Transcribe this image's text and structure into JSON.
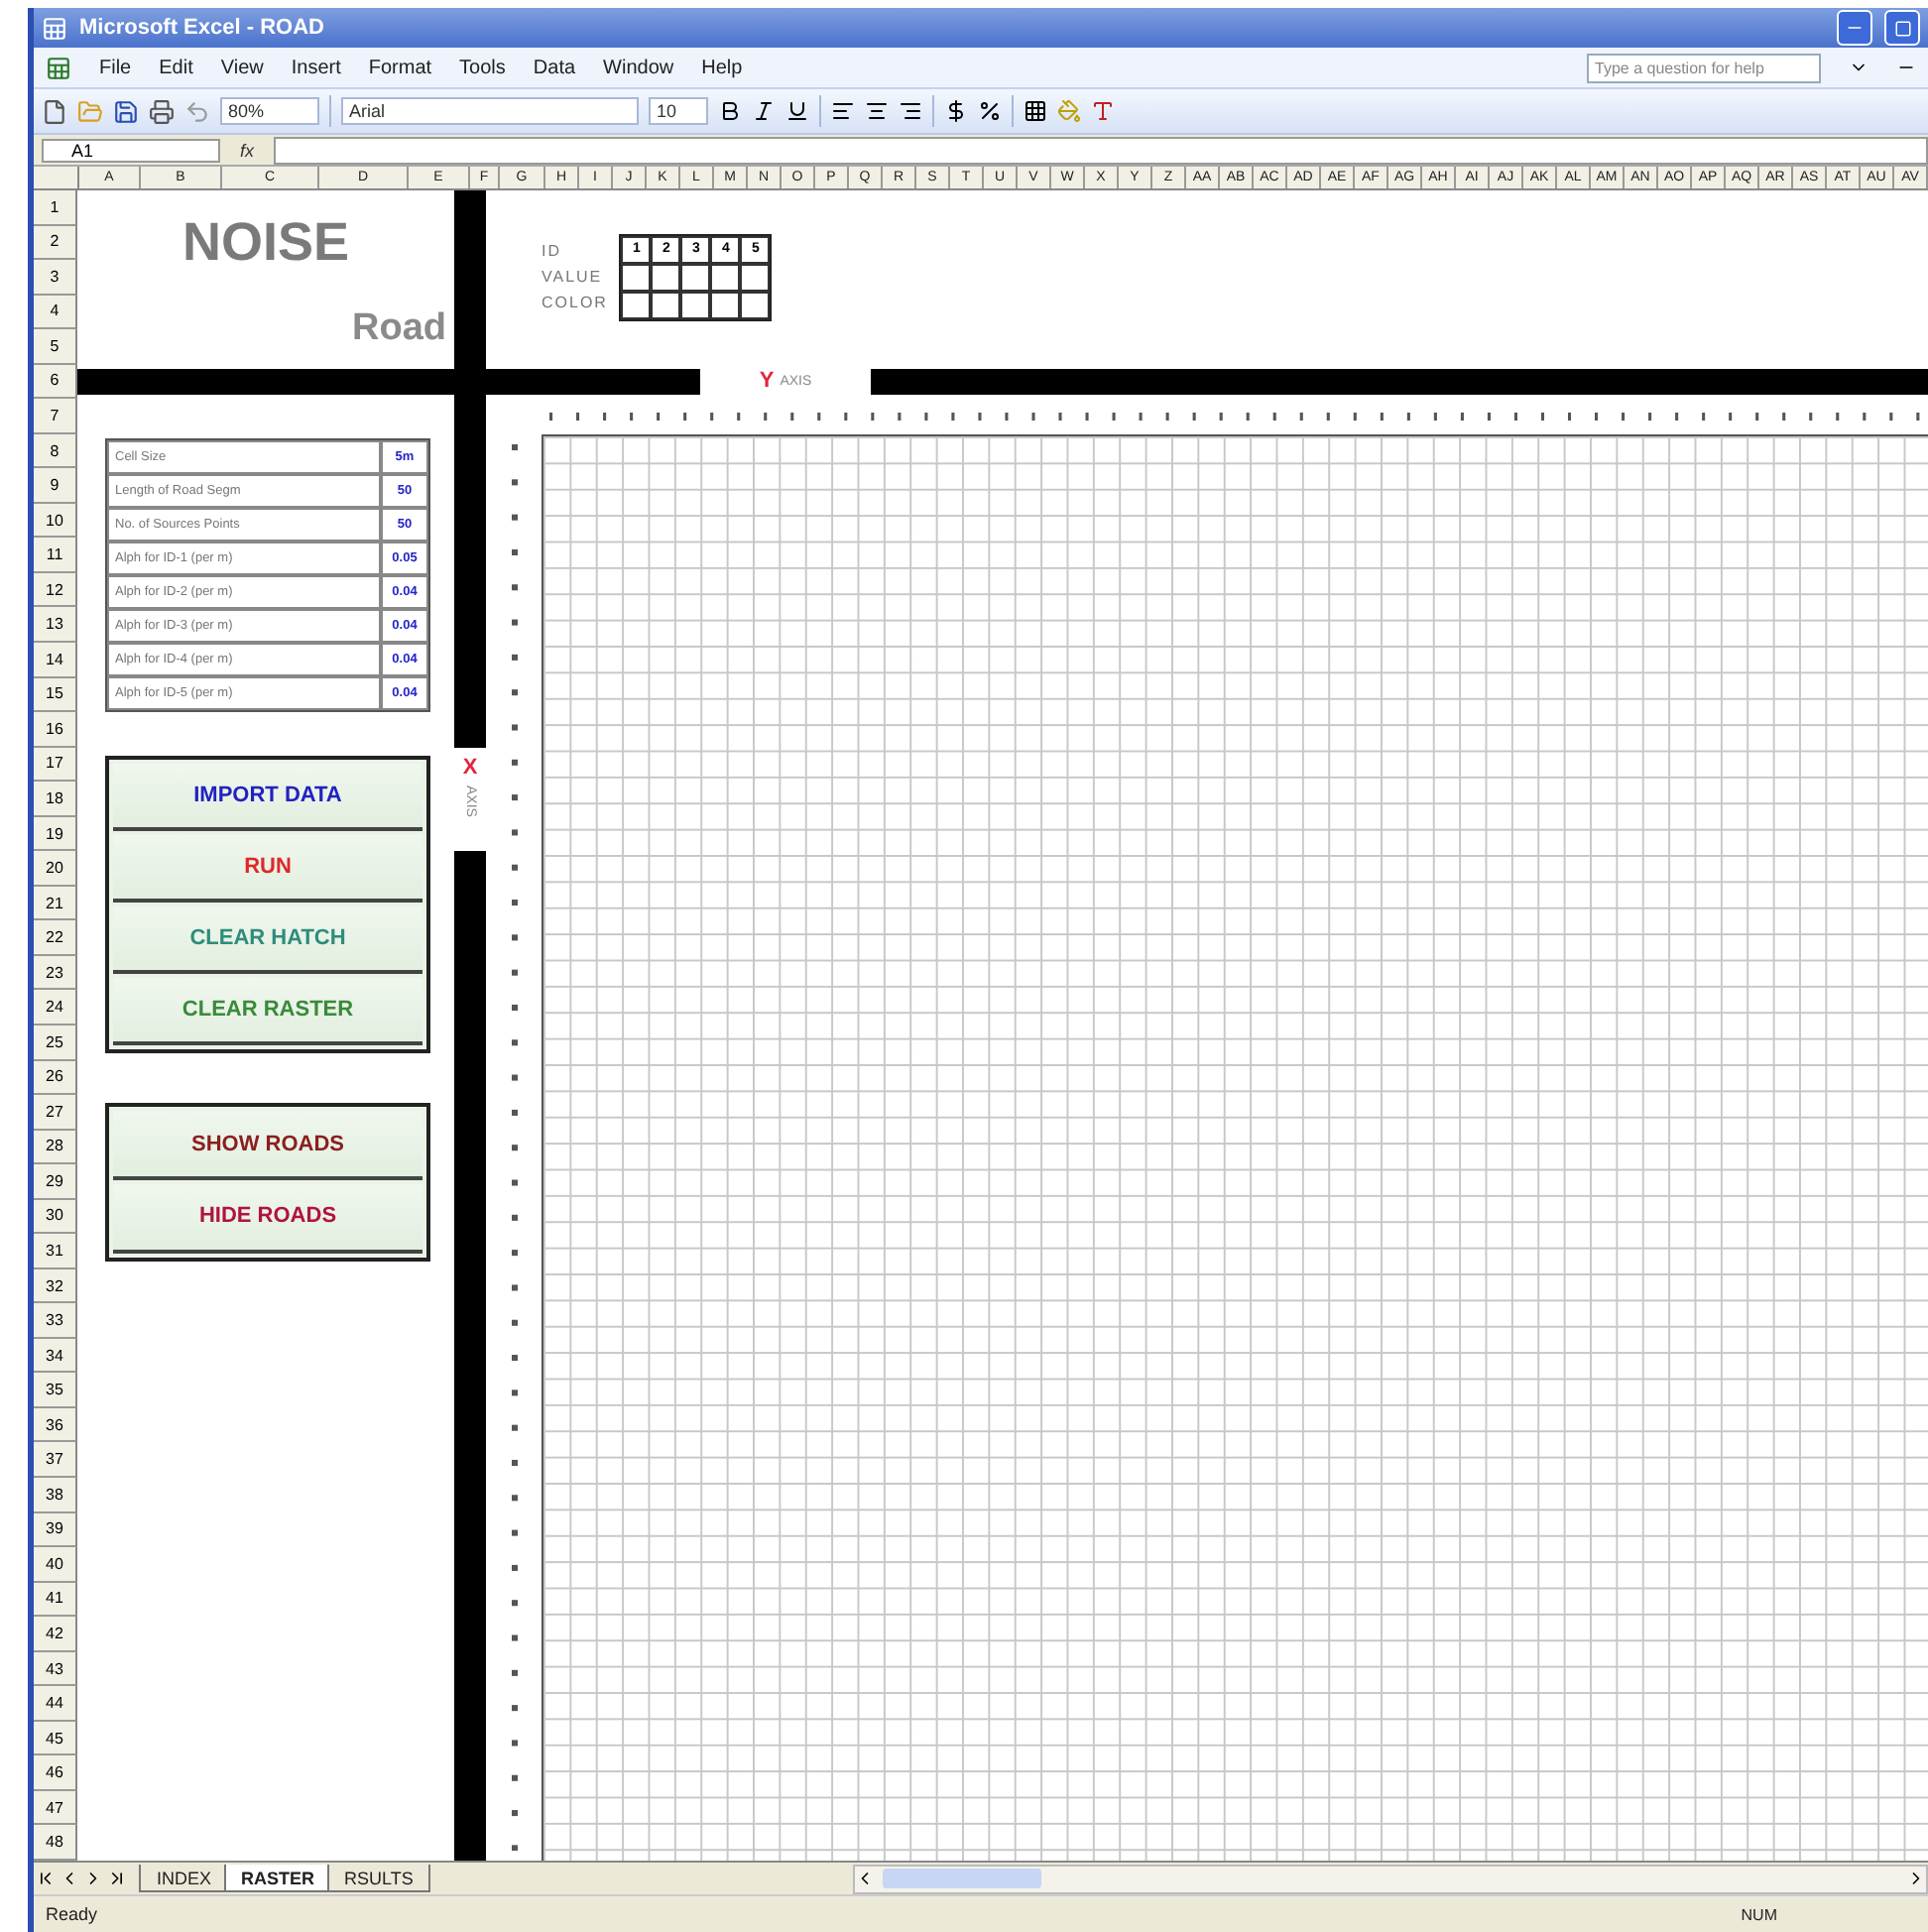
{
  "window": {
    "title": "Microsoft Excel - ROAD"
  },
  "menu": [
    "File",
    "Edit",
    "View",
    "Insert",
    "Format",
    "Tools",
    "Data",
    "Window",
    "Help"
  ],
  "help_box": {
    "placeholder": "Type a question for help"
  },
  "toolbar": {
    "zoom": "80%",
    "font": "Arial",
    "font_size": "10"
  },
  "formula_bar": {
    "name_box": "A1",
    "fx": "fx"
  },
  "columns": [
    "A",
    "B",
    "C",
    "D",
    "E",
    "F",
    "G",
    "H",
    "I",
    "J",
    "K",
    "L",
    "M",
    "N",
    "O",
    "P",
    "Q",
    "R",
    "S",
    "T",
    "U",
    "V",
    "W",
    "X",
    "Y",
    "Z",
    "AA",
    "AB",
    "AC",
    "AD",
    "AE",
    "AF",
    "AG",
    "AH",
    "AI",
    "AJ",
    "AK",
    "AL",
    "AM",
    "AN",
    "AO",
    "AP",
    "AQ",
    "AR",
    "AS",
    "AT",
    "AU",
    "AV"
  ],
  "rows": [
    "1",
    "2",
    "3",
    "4",
    "5",
    "6",
    "7",
    "8",
    "9",
    "10",
    "11",
    "12",
    "13",
    "14",
    "15",
    "16",
    "17",
    "18",
    "19",
    "20",
    "21",
    "22",
    "23",
    "24",
    "25",
    "26",
    "27",
    "28",
    "29",
    "30",
    "31",
    "32",
    "33",
    "34",
    "35",
    "36",
    "37",
    "38",
    "39",
    "40",
    "41",
    "42",
    "43",
    "44",
    "45",
    "46",
    "47",
    "48"
  ],
  "sheet": {
    "title": "NOISE",
    "subtitle": "Road",
    "legend": {
      "labels": [
        "ID",
        "VALUE",
        "COLOR"
      ],
      "ids": [
        "1",
        "2",
        "3",
        "4",
        "5"
      ]
    },
    "y_axis": {
      "letter": "Y",
      "label": "AXIS"
    },
    "x_axis": {
      "letter": "X",
      "label": "AXIS"
    },
    "parameters": [
      {
        "label": "Cell Size",
        "value": "5m"
      },
      {
        "label": "Length of Road Segm",
        "value": "50"
      },
      {
        "label": "No. of Sources Points",
        "value": "50"
      },
      {
        "label": "Alph for ID-1 (per m)",
        "value": "0.05"
      },
      {
        "label": "Alph for ID-2 (per m)",
        "value": "0.04"
      },
      {
        "label": "Alph for ID-3 (per m)",
        "value": "0.04"
      },
      {
        "label": "Alph for ID-4 (per m)",
        "value": "0.04"
      },
      {
        "label": "Alph for ID-5 (per m)",
        "value": "0.04"
      }
    ],
    "button_groups": [
      [
        {
          "label": "IMPORT  DATA",
          "color": "#2222c0"
        },
        {
          "label": "RUN",
          "color": "#e02828"
        },
        {
          "label": "CLEAR HATCH",
          "color": "#2f8c7c"
        },
        {
          "label": "CLEAR RASTER",
          "color": "#3a8a3a"
        }
      ],
      [
        {
          "label": "SHOW ROADS",
          "color": "#8b1e1e"
        },
        {
          "label": "HIDE ROADS",
          "color": "#b0143c"
        }
      ]
    ]
  },
  "sheet_tabs": [
    {
      "label": "INDEX",
      "selected": false
    },
    {
      "label": "RASTER",
      "selected": true
    },
    {
      "label": "RSULTS",
      "selected": false
    }
  ],
  "status_bar": {
    "state": "Ready",
    "indicator": "NUM"
  }
}
